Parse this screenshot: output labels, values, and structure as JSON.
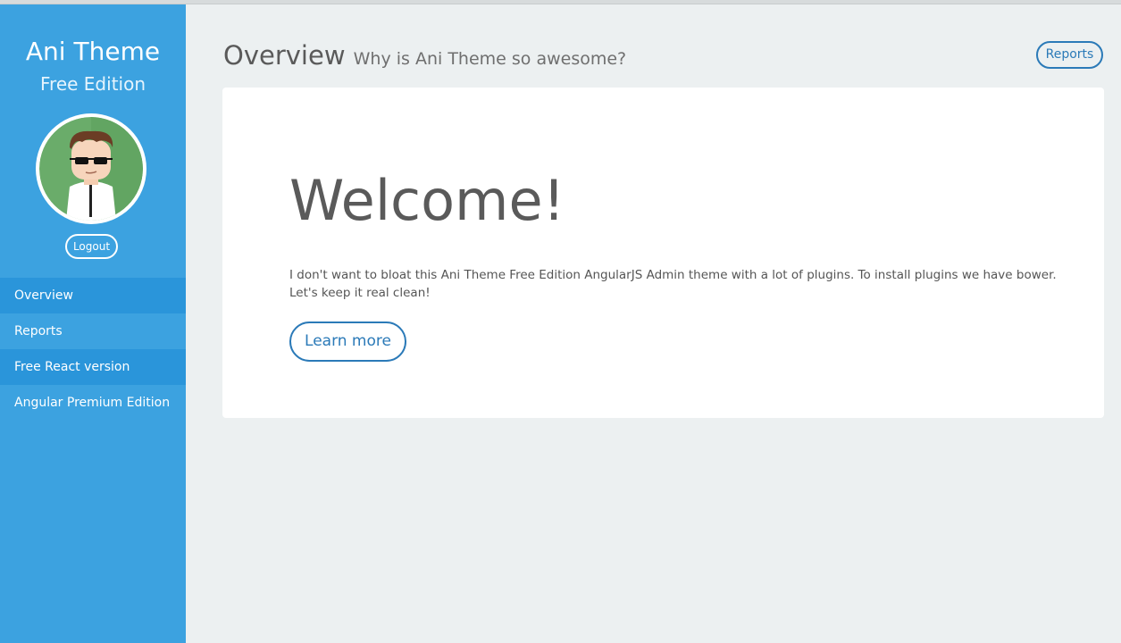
{
  "sidebar": {
    "brand_title": "Ani Theme",
    "brand_subtitle": "Free Edition",
    "avatar_icon": "user-avatar-icon",
    "logout_label": "Logout",
    "nav": [
      {
        "label": "Overview"
      },
      {
        "label": "Reports"
      },
      {
        "label": "Free React version"
      },
      {
        "label": "Angular Premium Edition"
      }
    ]
  },
  "header": {
    "title": "Overview",
    "subtitle": "Why is Ani Theme so awesome?",
    "reports_button": "Reports"
  },
  "panel": {
    "heading": "Welcome!",
    "description": "I don't want to bloat this Ani Theme Free Edition AngularJS Admin theme with a lot of plugins. To install plugins we have bower. Let's keep it real clean!",
    "learn_more": "Learn more"
  },
  "colors": {
    "sidebar_bg": "#3ca2e0",
    "sidebar_active": "#2a95da",
    "page_bg": "#ecf0f1",
    "accent": "#2b7ab8"
  }
}
